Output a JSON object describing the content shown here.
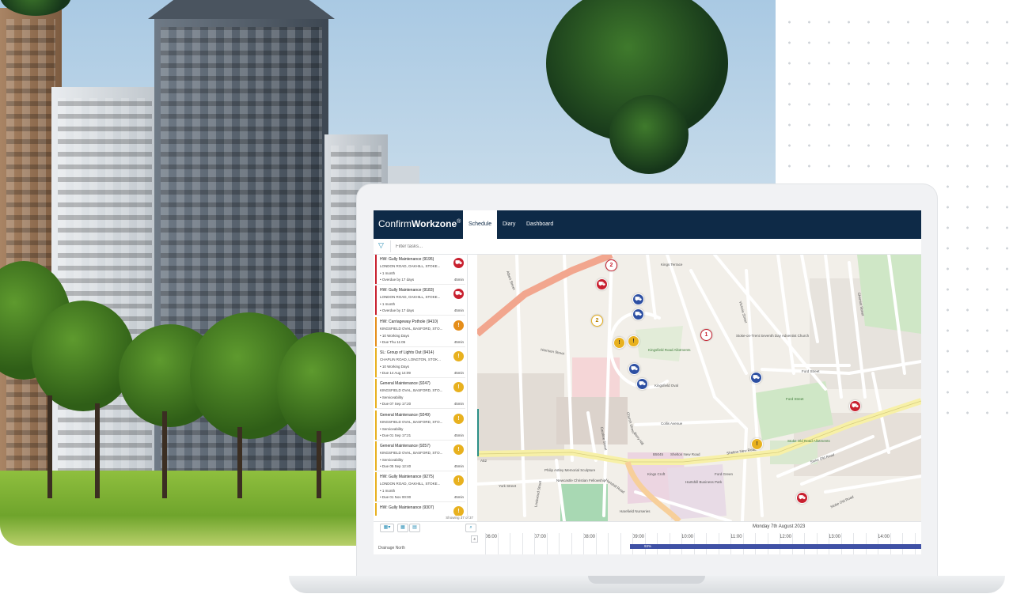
{
  "app": {
    "brand_light": "Confirm",
    "brand_bold": "Workzone",
    "brand_reg": "®",
    "tabs": [
      "Schedule",
      "Diary",
      "Dashboard"
    ],
    "active_tab": "Schedule"
  },
  "filter": {
    "placeholder": "Filter tasks..."
  },
  "tasks": [
    {
      "title": "HW: Gully Maintenance (9195)",
      "address": "LONDON ROAD, OAKHILL, STOKE...",
      "meta1": "• 1 month",
      "meta2": "• Overdue by 17 days",
      "duration": "45min",
      "color": "#c8202f",
      "icon": "vehicle-icon"
    },
    {
      "title": "HW: Gully Maintenance (9183)",
      "address": "LONDON ROAD, OAKHILL, STOKE...",
      "meta1": "• 1 month",
      "meta2": "• Overdue by 17 days",
      "duration": "45min",
      "color": "#c8202f",
      "icon": "vehicle-icon"
    },
    {
      "title": "HW: Carriageway Pothole (9410)",
      "address": "KINGSFIELD OVAL, BASFORD, STO...",
      "meta1": "• 10 Working Days",
      "meta2": "• Due Thu 11:05",
      "duration": "45min",
      "color": "#e58e1a",
      "icon": "warning-icon"
    },
    {
      "title": "SL: Group of Lights Out (9414)",
      "address": "CHAPLIN ROAD, LONGTON, STOK...",
      "meta1": "• 10 Working Days",
      "meta2": "• Due 14 Aug 14:09",
      "duration": "45min",
      "color": "#e8b11f",
      "icon": "warning-icon"
    },
    {
      "title": "General Maintenance (9247)",
      "address": "KINGSFIELD OVAL, BASFORD, STO...",
      "meta1": "• Serviceability",
      "meta2": "• Due 07 Sep 17:20",
      "duration": "45min",
      "color": "#e8b11f",
      "icon": "warning-icon"
    },
    {
      "title": "General Maintenance (9249)",
      "address": "KINGSFIELD OVAL, BASFORD, STO...",
      "meta1": "• Serviceability",
      "meta2": "• Due 01 Sep 17:21",
      "duration": "45min",
      "color": "#e8b11f",
      "icon": "warning-icon"
    },
    {
      "title": "General Maintenance (9257)",
      "address": "KINGSFIELD OVAL, BASFORD, STO...",
      "meta1": "• Serviceability",
      "meta2": "• Due 05 Sep 12:40",
      "duration": "45min",
      "color": "#e8b11f",
      "icon": "warning-icon"
    },
    {
      "title": "HW: Gully Maintenance (9275)",
      "address": "LONDON ROAD, OAKHILL, STOKE...",
      "meta1": "• 1 month",
      "meta2": "• Due 01 Nov 00:00",
      "duration": "45min",
      "color": "#e8b11f",
      "icon": "warning-icon"
    },
    {
      "title": "HW: Gully Maintenance (9307)",
      "address": "",
      "meta1": "",
      "meta2": "",
      "duration": "",
      "color": "#e8b11f",
      "icon": "warning-icon"
    }
  ],
  "showing": "Showing 37 of 37",
  "map": {
    "labels": [
      "Kings Terrace",
      "Harrison Street",
      "Kingsfield Oval",
      "Kingsfield Road Allotments",
      "Collis Avenue",
      "Shelton New Road",
      "Shelton New Road",
      "B5045",
      "Victoria Street",
      "Ford Street",
      "Ford Street",
      "Stoke Old Road",
      "York Street",
      "Hartshill Road",
      "Stoke Old Road",
      "Lockwood Street",
      "Chemist Street",
      "Stoke-on-Trent Seventh Day Adventist Church",
      "Newcastle Christian Fellowship",
      "Philip Astley Memorial Sculpture",
      "Kings Croft",
      "Hartshill Business Park",
      "Ford Green",
      "Stoke Old Road Allotments",
      "Harefield Nurseries",
      "A52",
      "Albert Street",
      "Church Street",
      "Berry Hill",
      "Caroline Street"
    ]
  },
  "timeline": {
    "date": "Monday 7th August 2023",
    "hours": [
      "06:00",
      "07:00",
      "08:00",
      "09:00",
      "10:00",
      "11:00",
      "12:00",
      "13:00",
      "14:00"
    ],
    "row_label": "Drainage North",
    "progress_label": "93%",
    "progress": 0.93,
    "day_count": "4"
  }
}
